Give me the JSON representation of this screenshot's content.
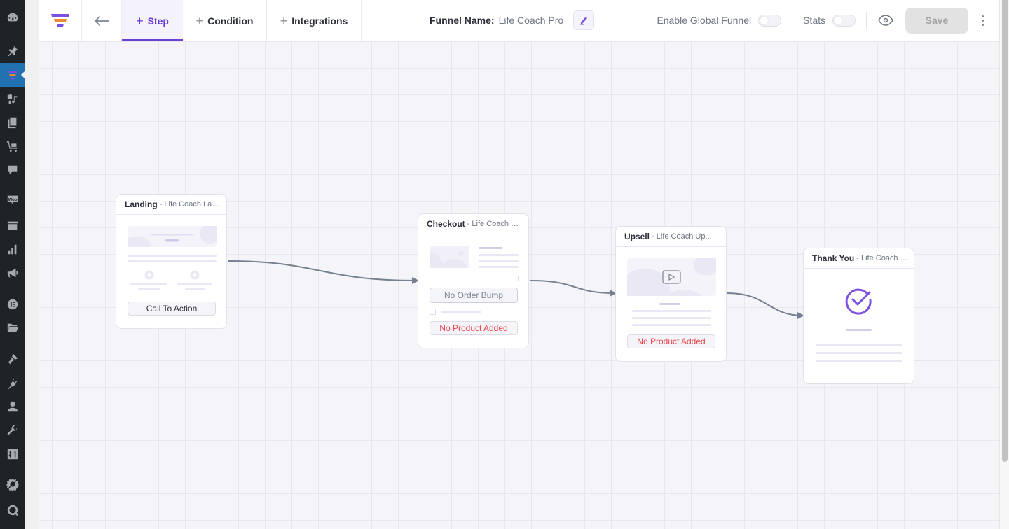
{
  "sidebar": {
    "items": [
      {
        "name": "dashboard-icon",
        "active": false
      },
      {
        "name": "posts-pin-icon",
        "active": false
      },
      {
        "name": "funnel-icon",
        "active": true
      },
      {
        "name": "media-icon",
        "active": false
      },
      {
        "name": "pages-icon",
        "active": false
      },
      {
        "name": "woo-cart-icon",
        "active": false
      },
      {
        "name": "comments-icon",
        "active": false
      },
      {
        "name": "woo-icon",
        "active": false
      },
      {
        "name": "archive-icon",
        "active": false
      },
      {
        "name": "analytics-icon",
        "active": false
      },
      {
        "name": "marketing-megaphone-icon",
        "active": false
      },
      {
        "name": "elementor-icon",
        "active": false
      },
      {
        "name": "folder-icon",
        "active": false
      },
      {
        "name": "appearance-brush-icon",
        "active": false
      },
      {
        "name": "plugins-icon",
        "active": false
      },
      {
        "name": "users-icon",
        "active": false
      },
      {
        "name": "tools-wrench-icon",
        "active": false
      },
      {
        "name": "settings-sliders-icon",
        "active": false
      },
      {
        "name": "gear-slash-icon",
        "active": false
      },
      {
        "name": "q-plugin-icon",
        "active": false
      }
    ]
  },
  "topbar": {
    "tabs": [
      {
        "label": "Step",
        "active": true
      },
      {
        "label": "Condition",
        "active": false
      },
      {
        "label": "Integrations",
        "active": false
      }
    ],
    "funnel_name_label": "Funnel Name:",
    "funnel_name_value": "Life Coach Pro",
    "global_funnel_label": "Enable Global Funnel",
    "global_funnel_enabled": false,
    "stats_label": "Stats",
    "stats_enabled": false,
    "save_label": "Save",
    "plus": "+",
    "back_arrow": "←"
  },
  "colors": {
    "accent": "#6b3fd4",
    "brand_orange": "#f08a30",
    "error": "#e5484d",
    "edge": "#76808e"
  },
  "nodes": [
    {
      "type": "Landing",
      "subtitle": "- Life Coach Lan...",
      "cta": "Call To Action"
    },
    {
      "type": "Checkout",
      "subtitle": "- Life Coach Ch...",
      "order_bump": "No Order Bump",
      "product": "No Product Added"
    },
    {
      "type": "Upsell",
      "subtitle": "- Life Coach Up...",
      "product": "No Product Added"
    },
    {
      "type": "Thank You",
      "subtitle": "- Life Coach Tha..."
    }
  ]
}
